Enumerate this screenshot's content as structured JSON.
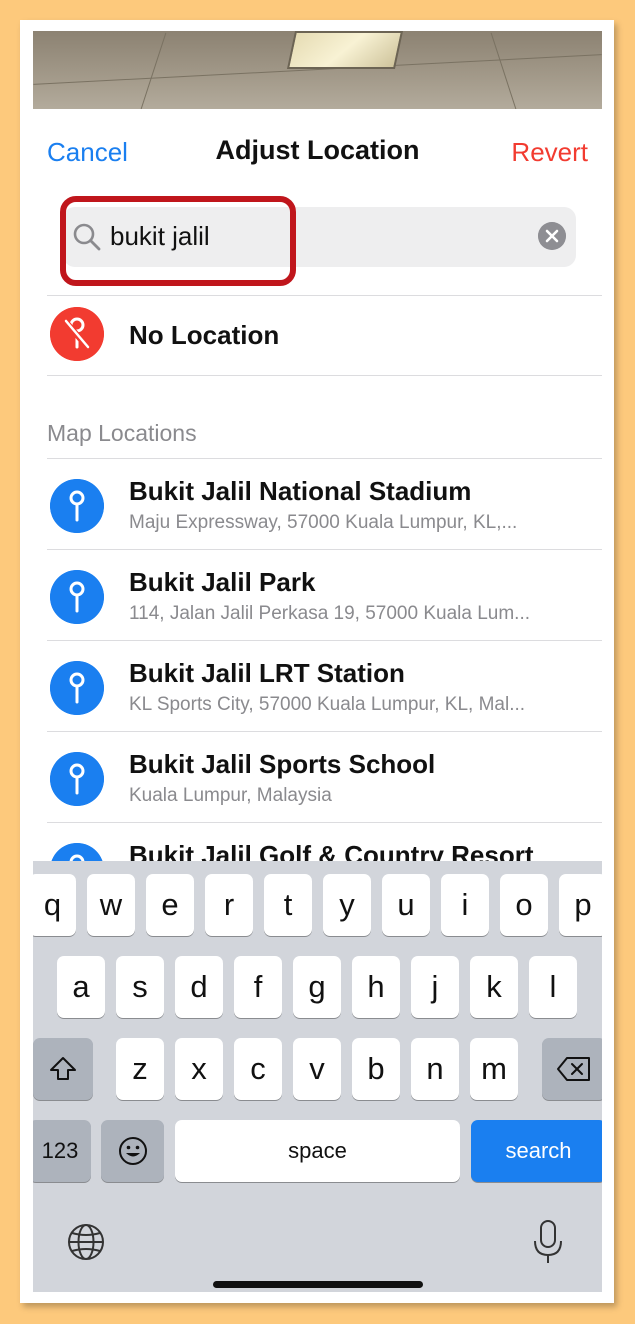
{
  "nav": {
    "cancel": "Cancel",
    "title": "Adjust Location",
    "revert": "Revert"
  },
  "search": {
    "value": "bukit jalil"
  },
  "no_location": {
    "label": "No Location"
  },
  "section_header": "Map Locations",
  "results": [
    {
      "title": "Bukit Jalil National Stadium",
      "subtitle": "Maju Expressway, 57000 Kuala Lumpur, KL,..."
    },
    {
      "title": "Bukit Jalil Park",
      "subtitle": "114, Jalan Jalil Perkasa 19, 57000 Kuala Lum..."
    },
    {
      "title": "Bukit Jalil LRT Station",
      "subtitle": "KL Sports City, 57000 Kuala Lumpur, KL, Mal..."
    },
    {
      "title": "Bukit Jalil Sports School",
      "subtitle": "Kuala Lumpur, Malaysia"
    },
    {
      "title": "Bukit Jalil Golf & Country Resort",
      "subtitle": ""
    }
  ],
  "keyboard": {
    "row1": [
      "q",
      "w",
      "e",
      "r",
      "t",
      "y",
      "u",
      "i",
      "o",
      "p"
    ],
    "row2": [
      "a",
      "s",
      "d",
      "f",
      "g",
      "h",
      "j",
      "k",
      "l"
    ],
    "row3": [
      "z",
      "x",
      "c",
      "v",
      "b",
      "n",
      "m"
    ],
    "numbers": "123",
    "space": "space",
    "search": "search"
  },
  "colors": {
    "accent": "#1a7ff0",
    "destructive": "#f23b30",
    "highlight": "#c0161c"
  }
}
